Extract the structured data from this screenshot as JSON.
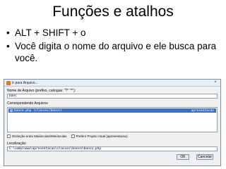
{
  "slide": {
    "title": "Funções e atalhos",
    "bullets": [
      "ALT +  SHIFT + o",
      "Você digita o nome do arquivo e ele busca para você."
    ]
  },
  "dialog": {
    "title": "Ir para Arquivo...",
    "close_label": "×",
    "name_label": "Nome de Arquivo (prefixo, curingas: \"?\" \"*\"):",
    "name_value": "banc",
    "matches_label": "Correspondendo Arquivos",
    "match": {
      "file": "banco.php  (classes/banco)",
      "project": "apresentacao"
    },
    "checks": [
      "Distinção entre Maiúsculas/Minúsculas",
      "Preferir Projeto Atual (apresentacao)"
    ],
    "location_label": "Localização:",
    "location_value": "C:\\xamp\\www\\apresentacao\\classes\\banco\\banco.php",
    "ok_label": "OK",
    "cancel_label": "Cancelar"
  }
}
